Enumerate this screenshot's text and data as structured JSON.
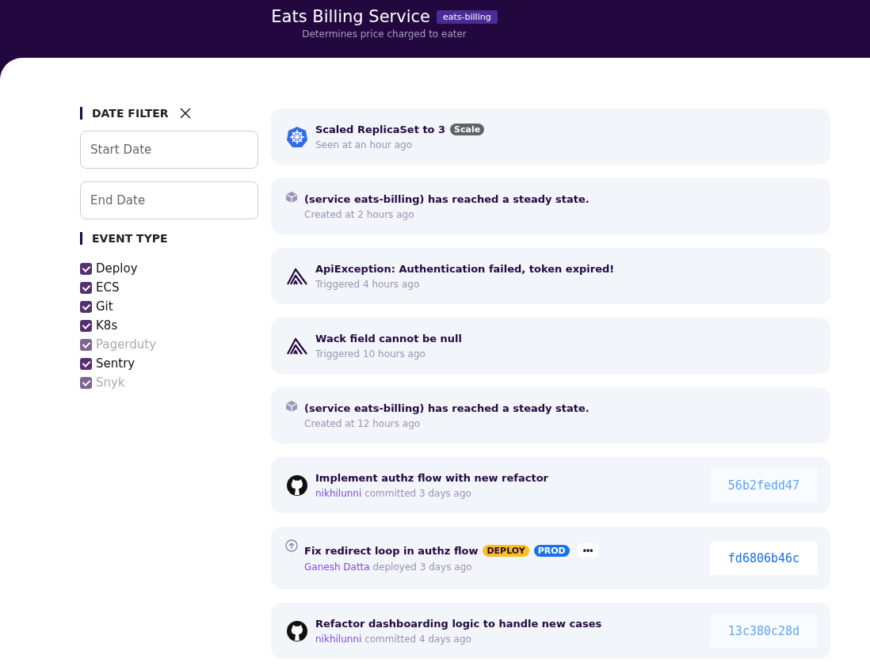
{
  "header": {
    "title": "Eats Billing Service",
    "tag": "eats-billing",
    "subtitle": "Determines price charged to eater"
  },
  "date_filter": {
    "heading": "DATE FILTER",
    "start_placeholder": "Start Date",
    "end_placeholder": "End Date"
  },
  "event_type": {
    "heading": "EVENT TYPE",
    "options": [
      {
        "label": "Deploy",
        "checked": true,
        "disabled": false
      },
      {
        "label": "ECS",
        "checked": true,
        "disabled": false
      },
      {
        "label": "Git",
        "checked": true,
        "disabled": false
      },
      {
        "label": "K8s",
        "checked": true,
        "disabled": false
      },
      {
        "label": "Pagerduty",
        "checked": true,
        "disabled": true
      },
      {
        "label": "Sentry",
        "checked": true,
        "disabled": false
      },
      {
        "label": "Snyk",
        "checked": true,
        "disabled": true
      }
    ]
  },
  "events": [
    {
      "kind": "k8s",
      "title": "Scaled ReplicaSet to 3",
      "badges": [
        {
          "kind": "scale",
          "label": "Scale"
        }
      ],
      "meta": "Seen at an hour ago"
    },
    {
      "kind": "ecs",
      "title": "(service eats-billing) has reached a steady state.",
      "meta": "Created at 2 hours ago"
    },
    {
      "kind": "sentry",
      "title": "ApiException: Authentication failed, token expired!",
      "meta": "Triggered 4 hours ago"
    },
    {
      "kind": "sentry",
      "title": "Wack field cannot be null",
      "meta": "Triggered 10 hours ago"
    },
    {
      "kind": "ecs",
      "title": "(service eats-billing) has reached a steady state.",
      "meta": "Created at 12 hours ago"
    },
    {
      "kind": "git",
      "title": "Implement authz flow with new refactor",
      "author": "nikhilunni",
      "meta": "committed 3 days ago",
      "hash": "56b2fedd47"
    },
    {
      "kind": "deploy",
      "title": "Fix redirect loop in authz flow",
      "badges": [
        {
          "kind": "deploy",
          "label": "DEPLOY"
        },
        {
          "kind": "env",
          "label": "PROD"
        }
      ],
      "more": "•••",
      "author": "Ganesh Datta",
      "meta": "deployed 3 days ago",
      "hash": "fd6806b46c"
    },
    {
      "kind": "git",
      "title": "Refactor dashboarding logic to handle new cases",
      "author": "nikhilunni",
      "meta": "committed 4 days ago",
      "hash": "13c380c28d"
    }
  ]
}
